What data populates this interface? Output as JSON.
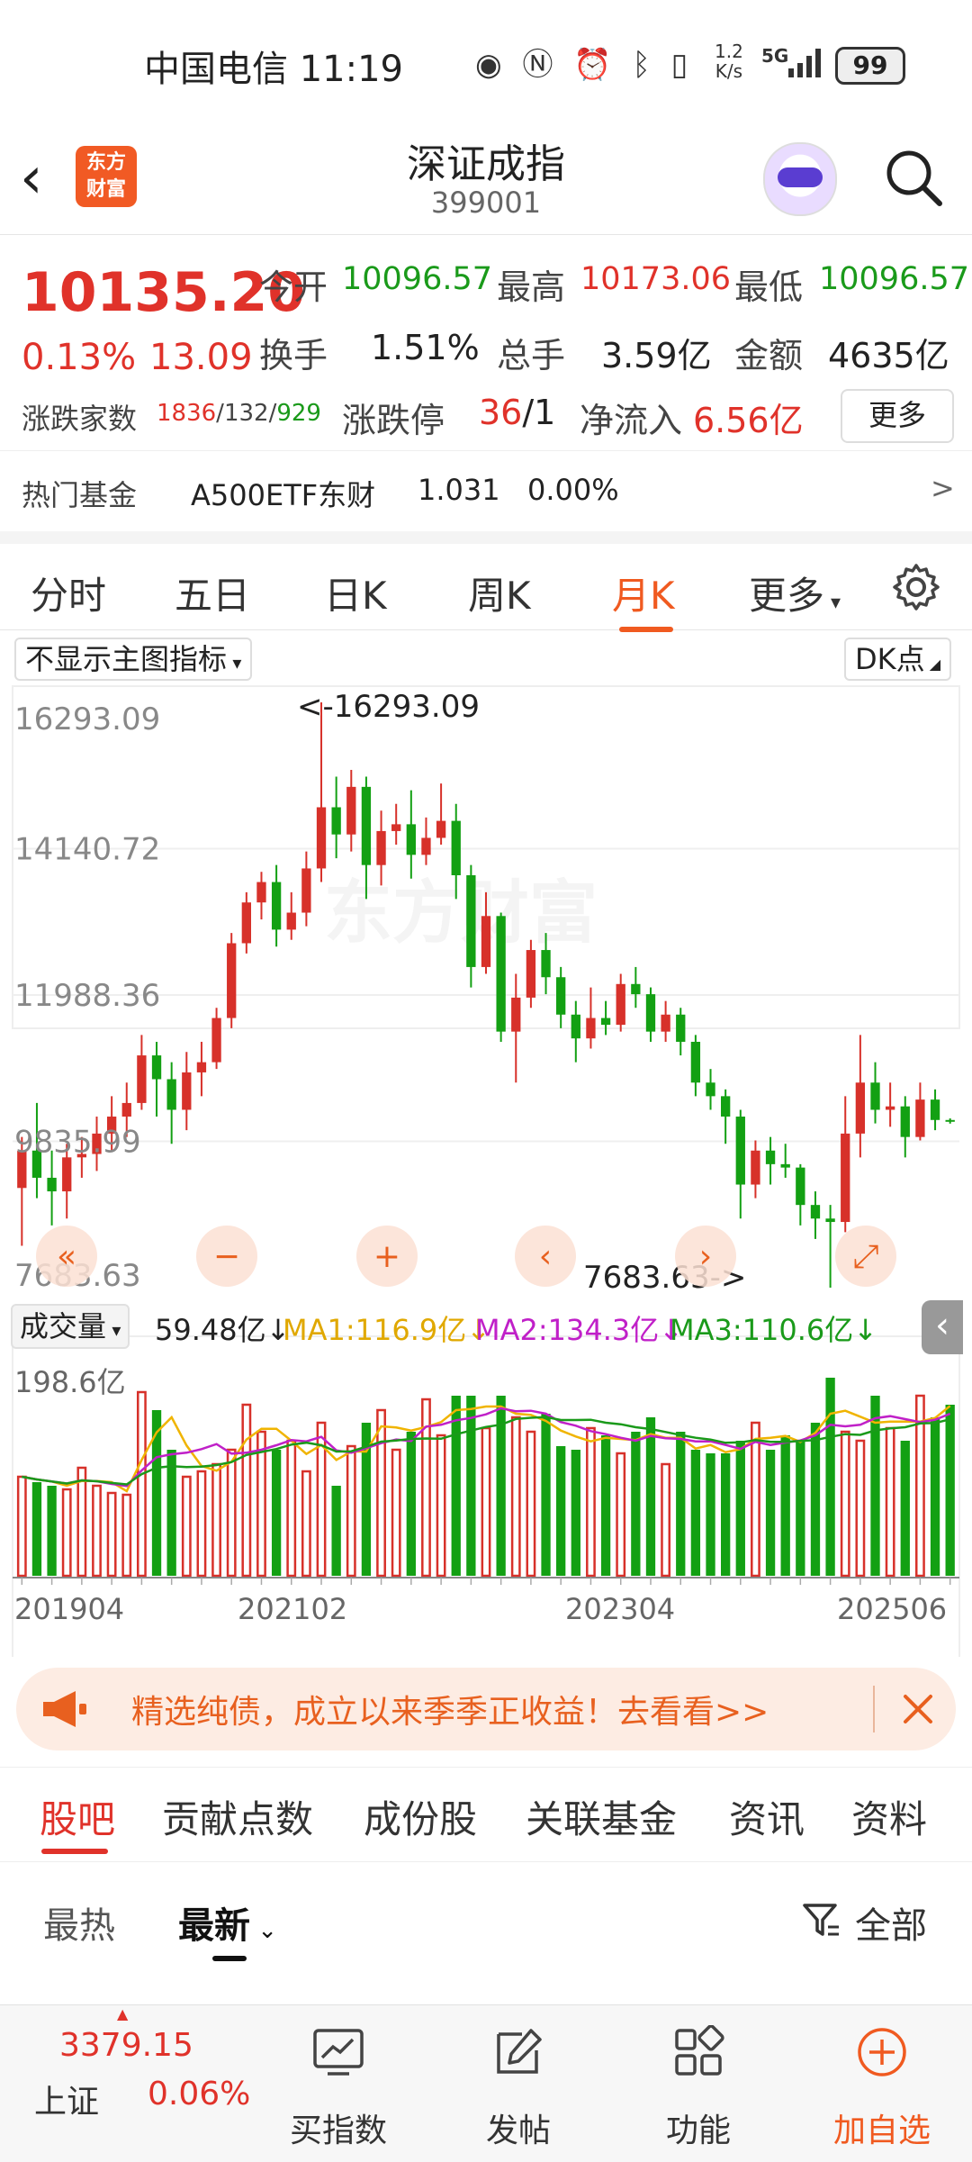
{
  "status_bar": {
    "carrier_time": "中国电信 11:19",
    "net_speed_top": "1.2",
    "net_speed_bottom": "K/s",
    "signal": "5G",
    "battery": "99"
  },
  "header": {
    "logo_line1": "东方",
    "logo_line2": "财富",
    "title": "深证成指",
    "code": "399001"
  },
  "quote": {
    "price": "10135.20",
    "change_pct": "0.13%",
    "change": "13.09",
    "open_label": "今开",
    "open": "10096.57",
    "high_label": "最高",
    "high": "10173.06",
    "low_label": "最低",
    "low": "10096.57",
    "turnover_label": "换手",
    "turnover": "1.51%",
    "volume_label": "总手",
    "volume": "3.59亿",
    "amount_label": "金额",
    "amount": "4635亿",
    "adv_dec_label": "涨跌家数",
    "adv": "1836",
    "flat": "132",
    "dec": "929",
    "sep": "/",
    "limit_label": "涨跌停",
    "limit_up": "36",
    "limit_down": "1",
    "net_inflow_label": "净流入",
    "net_inflow": "6.56亿",
    "more_button": "更多",
    "hot_fund_label": "热门基金",
    "hot_fund_name": "A500ETF东财",
    "hot_fund_price": "1.031",
    "hot_fund_pct": "0.00%",
    "hot_fund_arrow": ">"
  },
  "tabs": [
    "分时",
    "五日",
    "日K",
    "周K",
    "月K",
    "更多"
  ],
  "active_tab": "月K",
  "chart_controls": {
    "indicator_dropdown": "不显示主图指标",
    "dk_button": "DK点"
  },
  "chart_data": {
    "type": "candlestick",
    "period": "monthly",
    "y_ticks": [
      "16293.09",
      "14140.72",
      "11988.36",
      "9835.99",
      "7683.63"
    ],
    "high_marker": "<-16293.09",
    "low_marker": "7683.63->",
    "x_ticks": [
      "201904",
      "202102",
      "202304",
      "202506"
    ],
    "ylim": [
      7683.63,
      16293.09
    ],
    "candles": [
      [
        9150,
        9700,
        8300,
        9900
      ],
      [
        9700,
        9300,
        9000,
        10400
      ],
      [
        9300,
        9100,
        8600,
        9700
      ],
      [
        9100,
        9600,
        8700,
        9800
      ],
      [
        9600,
        9650,
        9300,
        9900
      ],
      [
        9650,
        9950,
        9400,
        10200
      ],
      [
        9950,
        10200,
        9700,
        10500
      ],
      [
        10200,
        10400,
        9900,
        10700
      ],
      [
        10400,
        11100,
        10300,
        11400
      ],
      [
        11100,
        10750,
        10200,
        11300
      ],
      [
        10750,
        10300,
        9800,
        11000
      ],
      [
        10300,
        10850,
        10000,
        11150
      ],
      [
        10850,
        11000,
        10500,
        11300
      ],
      [
        11000,
        11650,
        10900,
        11800
      ],
      [
        11650,
        12750,
        11500,
        12900
      ],
      [
        12750,
        13350,
        12600,
        13500
      ],
      [
        13350,
        13650,
        13100,
        13800
      ],
      [
        13650,
        12950,
        12700,
        13900
      ],
      [
        12950,
        13200,
        12800,
        13500
      ],
      [
        13200,
        13850,
        13000,
        14100
      ],
      [
        13850,
        14750,
        13650,
        16293.09
      ],
      [
        14750,
        14350,
        14000,
        15200
      ],
      [
        14350,
        15050,
        14100,
        15300
      ],
      [
        15050,
        13900,
        13400,
        15200
      ],
      [
        13900,
        14400,
        13600,
        14700
      ],
      [
        14400,
        14500,
        14200,
        14800
      ],
      [
        14500,
        14050,
        13700,
        15000
      ],
      [
        14050,
        14300,
        13900,
        14600
      ],
      [
        14300,
        14550,
        14200,
        15100
      ],
      [
        14550,
        13750,
        13400,
        14800
      ],
      [
        13750,
        12400,
        12100,
        13900
      ],
      [
        12400,
        13150,
        12300,
        13500
      ],
      [
        13150,
        11450,
        11300,
        13200
      ],
      [
        11450,
        11950,
        10700,
        12300
      ],
      [
        11950,
        12650,
        11800,
        12800
      ],
      [
        12650,
        12250,
        12000,
        12900
      ],
      [
        12250,
        11700,
        11500,
        12400
      ],
      [
        11700,
        11350,
        11000,
        11900
      ],
      [
        11350,
        11650,
        11200,
        12100
      ],
      [
        11650,
        11550,
        11400,
        11900
      ],
      [
        11550,
        12150,
        11450,
        12300
      ],
      [
        12150,
        12000,
        11800,
        12400
      ],
      [
        12000,
        11450,
        11300,
        12100
      ],
      [
        11450,
        11700,
        11300,
        11900
      ],
      [
        11700,
        11300,
        11100,
        11800
      ],
      [
        11300,
        10700,
        10500,
        11400
      ],
      [
        10700,
        10500,
        10300,
        10900
      ],
      [
        10500,
        10200,
        9800,
        10600
      ],
      [
        10200,
        9200,
        8700,
        10300
      ],
      [
        9200,
        9700,
        9000,
        9850
      ],
      [
        9700,
        9500,
        9200,
        9900
      ],
      [
        9500,
        9450,
        9300,
        9800
      ],
      [
        9450,
        8900,
        8600,
        9500
      ],
      [
        8900,
        8700,
        8400,
        9100
      ],
      [
        8700,
        8650,
        7683.63,
        8900
      ],
      [
        8650,
        9950,
        8500,
        10500
      ],
      [
        9950,
        10700,
        9600,
        11400
      ],
      [
        10700,
        10300,
        10100,
        11000
      ],
      [
        10300,
        10350,
        10050,
        10700
      ],
      [
        10350,
        9900,
        9600,
        10500
      ],
      [
        9900,
        10450,
        9850,
        10700
      ],
      [
        10450,
        10150,
        10000,
        10600
      ],
      [
        10150,
        10135.2,
        10096.57,
        10173.06
      ]
    ]
  },
  "volume_panel": {
    "dropdown": "成交量",
    "current": "59.48亿↓",
    "ma1": "MA1:116.9亿↓",
    "ma2": "MA2:134.3亿↓",
    "ma3": "MA3:110.6亿↓",
    "max_label": "198.6亿",
    "ma1_color": "#f0b400",
    "ma2_color": "#c020c8",
    "ma3_color": "#1a9a1a",
    "volumes": [
      55,
      52,
      50,
      48,
      60,
      50,
      46,
      45,
      102,
      92,
      70,
      55,
      58,
      62,
      70,
      95,
      80,
      70,
      75,
      58,
      85,
      50,
      72,
      85,
      92,
      70,
      80,
      98,
      78,
      100,
      100,
      82,
      100,
      88,
      80,
      90,
      72,
      70,
      82,
      78,
      68,
      80,
      88,
      62,
      80,
      70,
      68,
      68,
      75,
      85,
      70,
      78,
      75,
      85,
      110,
      80,
      75,
      100,
      82,
      75,
      100,
      88,
      95
    ]
  },
  "nav_controls": [
    "«",
    "−",
    "+",
    "‹",
    "›",
    "⤢"
  ],
  "promo_banner": {
    "text": "精选纯债，成立以来季季正收益！去看看>>"
  },
  "lower_tabs": [
    "股吧",
    "贡献点数",
    "成份股",
    "关联基金",
    "资讯",
    "资料"
  ],
  "active_lower_tab": "股吧",
  "sort": {
    "hot": "最热",
    "newest": "最新",
    "filter": "全部"
  },
  "bottom_nav": {
    "index_name": "上证",
    "index_value": "3379.15",
    "index_pct": "0.06%",
    "items": [
      "买指数",
      "发帖",
      "功能",
      "加自选"
    ]
  }
}
